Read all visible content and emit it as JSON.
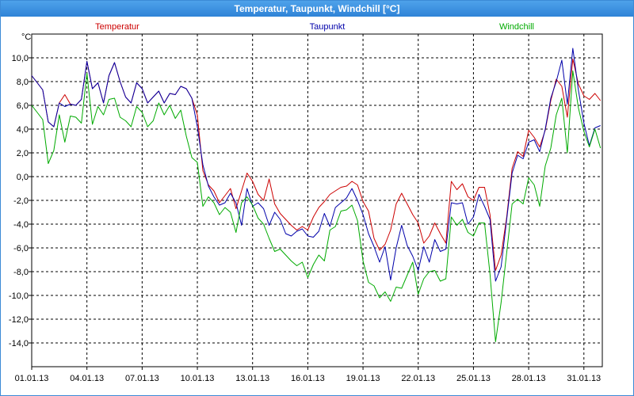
{
  "window": {
    "title": "Temperatur, Taupunkt, Windchill [°C]"
  },
  "chart_data": {
    "type": "line",
    "title": "Temperatur, Taupunkt, Windchill [°C]",
    "unit_label": "°C",
    "ylim": [
      -16,
      12
    ],
    "yticks": [
      10,
      8,
      6,
      4,
      2,
      0,
      -2,
      -4,
      -6,
      -8,
      -10,
      -12,
      -14
    ],
    "ytick_labels": [
      "10,0",
      "8,0",
      "6,0",
      "4,0",
      "2,0",
      "0,0",
      "-2,0",
      "-4,0",
      "-6,0",
      "-8,0",
      "-10,0",
      "-12,0",
      "-14,0"
    ],
    "xlim": [
      1,
      32
    ],
    "x_unit": "day of January 2013",
    "xticks": [
      1,
      4,
      7,
      10,
      13,
      16,
      19,
      22,
      25,
      28,
      31
    ],
    "xtick_labels": [
      "01.01.13",
      "04.01.13",
      "07.01.13",
      "10.01.13",
      "13.01.13",
      "16.01.13",
      "19.01.13",
      "22.01.13",
      "25.01.13",
      "28.01.13",
      "31.01.13"
    ],
    "grid": true,
    "legend_position": "top",
    "series": [
      {
        "name": "Temperatur",
        "color": "#cc0000",
        "x": [
          1.0,
          1.3,
          1.6,
          1.9,
          2.2,
          2.5,
          2.8,
          3.1,
          3.4,
          3.7,
          4.0,
          4.3,
          4.6,
          4.9,
          5.2,
          5.5,
          5.8,
          6.1,
          6.4,
          6.7,
          7.0,
          7.3,
          7.6,
          7.9,
          8.2,
          8.5,
          8.8,
          9.1,
          9.4,
          9.7,
          10.0,
          10.3,
          10.6,
          10.9,
          11.2,
          11.5,
          11.8,
          12.1,
          12.4,
          12.7,
          13.0,
          13.3,
          13.6,
          13.9,
          14.2,
          14.5,
          14.8,
          15.1,
          15.4,
          15.7,
          16.0,
          16.3,
          16.6,
          16.9,
          17.2,
          17.5,
          17.8,
          18.1,
          18.4,
          18.7,
          19.0,
          19.3,
          19.6,
          19.9,
          20.2,
          20.5,
          20.8,
          21.1,
          21.4,
          21.7,
          22.0,
          22.3,
          22.6,
          22.9,
          23.2,
          23.5,
          23.8,
          24.1,
          24.4,
          24.7,
          25.0,
          25.3,
          25.6,
          25.9,
          26.2,
          26.5,
          26.8,
          27.1,
          27.4,
          27.7,
          28.0,
          28.3,
          28.6,
          28.9,
          29.2,
          29.5,
          29.8,
          30.1,
          30.4,
          30.7,
          31.0,
          31.3,
          31.6,
          31.9
        ],
        "values": [
          8.5,
          7.9,
          7.3,
          4.6,
          4.2,
          6.2,
          6.9,
          6.1,
          6.0,
          6.5,
          9.7,
          7.4,
          7.9,
          6.2,
          8.5,
          9.6,
          8.0,
          6.7,
          6.2,
          7.9,
          7.4,
          6.2,
          6.7,
          7.2,
          6.2,
          7.0,
          6.9,
          7.6,
          7.4,
          6.6,
          5.2,
          0.5,
          -0.7,
          -1.2,
          -2.2,
          -1.6,
          -1.0,
          -2.7,
          -1.2,
          0.3,
          -0.4,
          -1.5,
          -2.0,
          -0.2,
          -2.3,
          -3.1,
          -3.6,
          -4.1,
          -4.5,
          -4.2,
          -4.5,
          -3.4,
          -2.6,
          -2.1,
          -1.5,
          -1.2,
          -0.9,
          -0.8,
          -0.4,
          -0.7,
          -2.1,
          -2.9,
          -5.2,
          -6.2,
          -5.7,
          -4.5,
          -2.3,
          -1.4,
          -2.3,
          -3.2,
          -3.9,
          -5.6,
          -5.0,
          -3.9,
          -4.8,
          -5.6,
          -0.4,
          -1.1,
          -0.6,
          -1.7,
          -2.0,
          -0.9,
          -0.9,
          -3.2,
          -7.9,
          -6.6,
          -3.5,
          0.7,
          2.1,
          1.7,
          3.9,
          3.3,
          2.5,
          3.9,
          6.4,
          8.2,
          7.6,
          5.0,
          9.9,
          7.8,
          6.8,
          6.5,
          7.0,
          6.4
        ]
      },
      {
        "name": "Taupunkt",
        "color": "#0000aa",
        "x": [
          1.0,
          1.3,
          1.6,
          1.9,
          2.2,
          2.5,
          2.8,
          3.1,
          3.4,
          3.7,
          4.0,
          4.3,
          4.6,
          4.9,
          5.2,
          5.5,
          5.8,
          6.1,
          6.4,
          6.7,
          7.0,
          7.3,
          7.6,
          7.9,
          8.2,
          8.5,
          8.8,
          9.1,
          9.4,
          9.7,
          10.0,
          10.3,
          10.6,
          10.9,
          11.2,
          11.5,
          11.8,
          12.1,
          12.4,
          12.7,
          13.0,
          13.3,
          13.6,
          13.9,
          14.2,
          14.5,
          14.8,
          15.1,
          15.4,
          15.7,
          16.0,
          16.3,
          16.6,
          16.9,
          17.2,
          17.5,
          17.8,
          18.1,
          18.4,
          18.7,
          19.0,
          19.3,
          19.6,
          19.9,
          20.2,
          20.5,
          20.8,
          21.1,
          21.4,
          21.7,
          22.0,
          22.3,
          22.6,
          22.9,
          23.2,
          23.5,
          23.8,
          24.1,
          24.4,
          24.7,
          25.0,
          25.3,
          25.6,
          25.9,
          26.2,
          26.5,
          26.8,
          27.1,
          27.4,
          27.7,
          28.0,
          28.3,
          28.6,
          28.9,
          29.2,
          29.5,
          29.8,
          30.1,
          30.4,
          30.7,
          31.0,
          31.3,
          31.6,
          31.9
        ],
        "values": [
          8.5,
          7.9,
          7.3,
          4.6,
          4.2,
          6.2,
          5.9,
          6.1,
          6.0,
          6.5,
          9.7,
          7.4,
          7.9,
          6.2,
          8.5,
          9.6,
          8.0,
          6.7,
          6.2,
          7.9,
          7.4,
          6.2,
          6.7,
          7.2,
          6.2,
          7.0,
          6.9,
          7.6,
          7.4,
          6.6,
          4.2,
          1.0,
          -0.8,
          -1.7,
          -2.4,
          -2.2,
          -1.4,
          -2.2,
          -4.1,
          -1.0,
          -2.5,
          -2.2,
          -2.7,
          -4.1,
          -3.0,
          -3.6,
          -4.8,
          -5.0,
          -4.6,
          -4.4,
          -5.0,
          -5.1,
          -4.6,
          -3.1,
          -4.2,
          -2.6,
          -2.2,
          -1.8,
          -1.0,
          -2.0,
          -3.2,
          -4.8,
          -5.9,
          -7.2,
          -5.9,
          -8.7,
          -6.0,
          -4.1,
          -5.8,
          -6.7,
          -7.9,
          -5.9,
          -7.2,
          -5.3,
          -6.3,
          -6.1,
          -2.2,
          -2.3,
          -2.2,
          -4.0,
          -3.4,
          -1.5,
          -2.5,
          -3.6,
          -8.8,
          -7.6,
          -3.7,
          0.3,
          1.8,
          1.5,
          2.9,
          3.1,
          2.1,
          4.0,
          6.6,
          8.0,
          9.8,
          6.1,
          10.8,
          7.3,
          4.5,
          2.6,
          4.1,
          4.3
        ]
      },
      {
        "name": "Windchill",
        "color": "#00aa00",
        "x": [
          1.0,
          1.3,
          1.6,
          1.9,
          2.2,
          2.5,
          2.8,
          3.1,
          3.4,
          3.7,
          4.0,
          4.3,
          4.6,
          4.9,
          5.2,
          5.5,
          5.8,
          6.1,
          6.4,
          6.7,
          7.0,
          7.3,
          7.6,
          7.9,
          8.2,
          8.5,
          8.8,
          9.1,
          9.4,
          9.7,
          10.0,
          10.3,
          10.6,
          10.9,
          11.2,
          11.5,
          11.8,
          12.1,
          12.4,
          12.7,
          13.0,
          13.3,
          13.6,
          13.9,
          14.2,
          14.5,
          14.8,
          15.1,
          15.4,
          15.7,
          16.0,
          16.3,
          16.6,
          16.9,
          17.2,
          17.5,
          17.8,
          18.1,
          18.4,
          18.7,
          19.0,
          19.3,
          19.6,
          19.9,
          20.2,
          20.5,
          20.8,
          21.1,
          21.4,
          21.7,
          22.0,
          22.3,
          22.6,
          22.9,
          23.2,
          23.5,
          23.8,
          24.1,
          24.4,
          24.7,
          25.0,
          25.3,
          25.6,
          25.9,
          26.2,
          26.5,
          26.8,
          27.1,
          27.4,
          27.7,
          28.0,
          28.3,
          28.6,
          28.9,
          29.2,
          29.5,
          29.8,
          30.1,
          30.4,
          30.7,
          31.0,
          31.3,
          31.6,
          31.9
        ],
        "values": [
          6.0,
          5.4,
          4.8,
          1.1,
          2.2,
          5.2,
          2.9,
          5.1,
          5.0,
          4.5,
          8.7,
          4.4,
          5.9,
          5.2,
          6.5,
          6.6,
          5.0,
          4.7,
          4.2,
          5.9,
          5.4,
          4.2,
          4.7,
          6.2,
          5.2,
          6.0,
          4.9,
          5.6,
          3.4,
          1.6,
          1.2,
          -2.5,
          -1.7,
          -2.2,
          -3.2,
          -2.6,
          -3.0,
          -4.7,
          -2.2,
          -1.7,
          -2.4,
          -3.5,
          -4.0,
          -5.2,
          -6.3,
          -6.1,
          -6.6,
          -7.1,
          -7.5,
          -7.2,
          -8.5,
          -7.4,
          -6.6,
          -7.1,
          -4.5,
          -4.2,
          -2.9,
          -2.8,
          -2.4,
          -3.7,
          -7.1,
          -8.9,
          -9.2,
          -10.2,
          -9.7,
          -10.5,
          -9.3,
          -9.4,
          -8.3,
          -7.2,
          -9.9,
          -8.6,
          -8.0,
          -7.9,
          -8.8,
          -8.6,
          -3.4,
          -4.1,
          -3.6,
          -4.7,
          -5.0,
          -3.9,
          -3.9,
          -8.2,
          -13.9,
          -10.6,
          -6.5,
          -2.3,
          -1.9,
          -2.3,
          -0.1,
          -0.7,
          -2.5,
          0.9,
          2.4,
          5.2,
          6.6,
          2.0,
          8.9,
          5.8,
          3.8,
          2.5,
          4.0,
          2.4
        ]
      }
    ]
  }
}
